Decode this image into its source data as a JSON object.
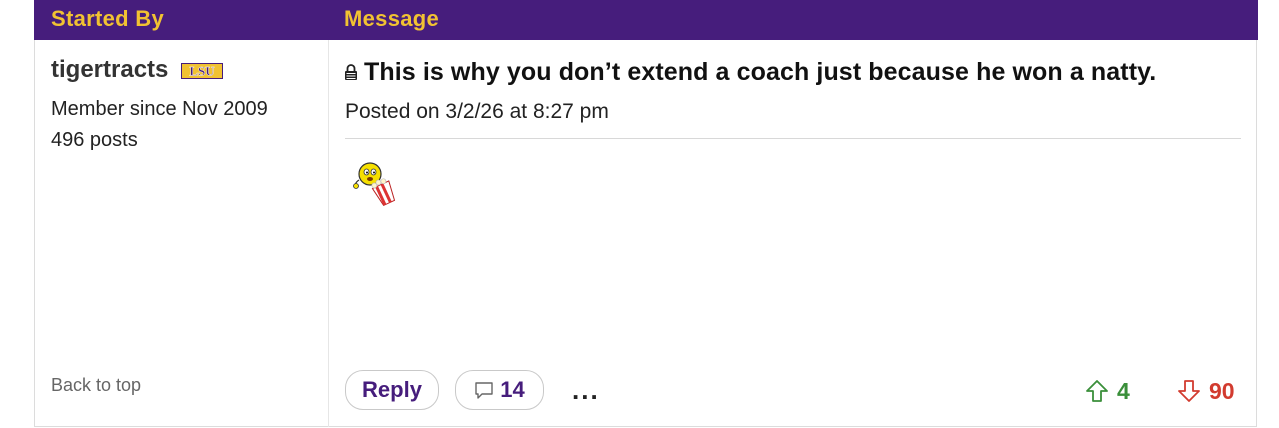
{
  "header": {
    "started_by": "Started By",
    "message": "Message"
  },
  "author": {
    "name": "tigertracts",
    "badge": "LSU",
    "member_since": "Member since Nov 2009",
    "posts": "496 posts",
    "back_to_top": "Back to top"
  },
  "post": {
    "title": "This is why you don’t extend a coach just because he won a natty.",
    "posted": "Posted on 3/2/26 at 8:27 pm",
    "emoji": "popcorn-smiley-icon"
  },
  "actions": {
    "reply_label": "Reply",
    "reply_count": "14",
    "more": "...",
    "upvotes": "4",
    "downvotes": "90"
  },
  "colors": {
    "header_bg": "#461d7c",
    "header_text": "#f1c232",
    "up": "#3a8f3a",
    "down": "#d23b2f"
  }
}
